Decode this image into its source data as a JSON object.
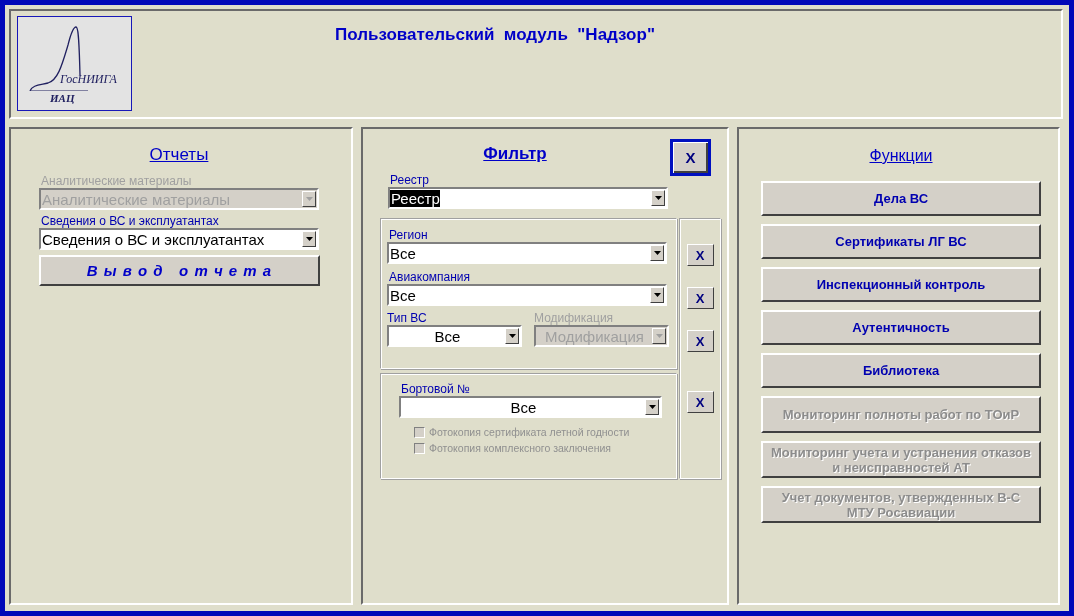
{
  "header": {
    "logo": {
      "org": "ГосНИИГА",
      "unit": "ИАЦ"
    },
    "title": "Пользовательский  модуль  \"Надзор\""
  },
  "reports": {
    "title": "Отчеты",
    "fields": [
      {
        "label": "Аналитические материалы",
        "value": "Аналитические материалы",
        "disabled": true
      },
      {
        "label": "Сведения о ВС и эксплуатантах",
        "value": "Сведения о ВС и эксплуатантах",
        "disabled": false
      }
    ],
    "button": "В ы в о д   о т ч е т а"
  },
  "filter": {
    "title": "Фильтр",
    "close_button": "X",
    "registry": {
      "label": "Реестр",
      "value": "Реестр",
      "highlighted": true
    },
    "group_1": {
      "fields": [
        {
          "label": "Регион",
          "value": "Все",
          "disabled": false
        },
        {
          "label": "Авиакомпания",
          "value": "Все",
          "disabled": false
        }
      ],
      "pair": [
        {
          "label": "Тип ВС",
          "value": "Все",
          "disabled": false
        },
        {
          "label": "Модификация",
          "value": "Модификация",
          "disabled": true
        }
      ]
    },
    "group_2": {
      "label": "Бортовой №",
      "value": "Все",
      "checkboxes": [
        {
          "label": "Фотокопия сертификата летной годности",
          "checked": false,
          "disabled": true
        },
        {
          "label": "Фотокопия комплексного заключения",
          "checked": false,
          "disabled": true
        }
      ]
    },
    "clear_buttons": [
      "X",
      "X",
      "X",
      "X"
    ]
  },
  "functions": {
    "title": "Функции",
    "buttons": [
      {
        "label": "Дела ВС",
        "disabled": false
      },
      {
        "label": "Сертификаты ЛГ ВС",
        "disabled": false
      },
      {
        "label": "Инспекционный контроль",
        "disabled": false
      },
      {
        "label": "Аутентичность",
        "disabled": false
      },
      {
        "label": "Библиотека",
        "disabled": false
      },
      {
        "label": "Мониторинг полноты работ по ТОиР",
        "disabled": true
      },
      {
        "label": "Мониторинг учета и устранения отказов и неисправностей АТ",
        "disabled": true
      },
      {
        "label": "Учет документов, утвержденных В-С МТУ Росавиации",
        "disabled": true
      }
    ]
  }
}
